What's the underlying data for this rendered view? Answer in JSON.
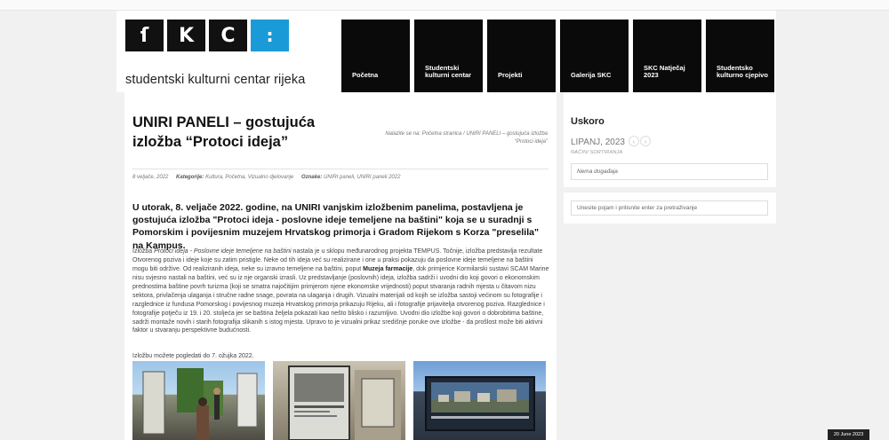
{
  "logo": {
    "letters": [
      "ſ",
      "K",
      "C",
      ":"
    ],
    "text": "studentski kulturni centar rijeka"
  },
  "nav": {
    "items": [
      {
        "label": "Početna"
      },
      {
        "label": "Studentski kulturni centar"
      },
      {
        "label": "Projekti"
      },
      {
        "label": "Galerija SKC"
      },
      {
        "label": "SKC Natječaj 2023"
      },
      {
        "label": "Studentsko kulturno cjepivo"
      }
    ]
  },
  "article": {
    "title": "UNIRI PANELI – gostujuća izložba “Protoci ideja”",
    "breadcrumb": "Nalazite se na: Početna stranica / UNIRI PANELI – gostujuća izložba “Protoci ideja”",
    "meta": {
      "date": "8 veljače, 2022",
      "categories_label": "Kategorije:",
      "categories": "Kultura, Početna, Vizualno djelovanje",
      "tags_label": "Oznake:",
      "tags": "UNIRI paneli, UNIRI paneli 2022"
    },
    "lead": "U utorak, 8. veljače 2022. godine, na UNIRI vanjskim izložbenim panelima, postavljena je gostujuća izložba \"Protoci ideja - poslovne ideje temeljene na baštini\" koja se u suradnji s Pomorskim i povijesnim muzejem Hrvatskog primorja i Gradom Rijekom s Korza \"preselila\" na Kampus.",
    "body": {
      "p1_intro": "Izložba ",
      "p1_title": "Protoci ideja - Poslovne ideje temeljene na baštini",
      "p1_a": " nastala je u sklopu međunarodnog projekta TEMPUS. Točnije, izložba predstavlja rezultate Otvorenog poziva i ideje koje su zatim pristigle. Neke od tih ideja već su realizirane i one u praksi pokazuju da poslovne ideje temeljene na baštini mogu biti održive. Od realiziranih ideja, neke su izravno temeljene na baštini, poput ",
      "p1_bold": "Muzeja farmacije",
      "p1_b": ", dok primjerice Kormilarski sustavi SCAM Marine nisu svjesno nastali na baštini, već su iz nje organski izrasli. Uz predstavljanje (poslovnih) ideja, izložba sadrži i uvodni dio koji govori o ekonomskim prednostima baštine povrh turizma (koji se smatra najočitijim primjerom njene ekonomske vrijednosti) poput stvaranja radnih mjesta u čitavom nizu sektora, privlačenja ulaganja i stručne radne snage, povrata na ulaganja i drugih. Vizualni materijali od kojih se izložba sastoji većinom su fotografije i razglednice iz fundusa Pomorskog i povijesnog muzeja Hrvatskog primorja prikazuju Rijeku, ali i fotografije prijavitelja otvorenog poziva. Razglednice i fotografije potječu iz 19. i 20. stoljeća jer se baština željela pokazati kao nešto blisko i razumljivo. Uvodni dio izložbe koji govori o dobrobitima baštine, sadrži montaže novih i starih fotografija slikanih s istog mjesta. Upravo to je vizualni prikaz središnje poruke ove izložbe - da prošlost može biti aktivni faktor u stvaranju perspektivne budućnosti."
    },
    "note": "Izložbu možete pogledati do 7. ožujka 2022."
  },
  "sidebar": {
    "upcoming_title": "Uskoro",
    "month": "LIPANJ, 2023",
    "prev_icon": "‹",
    "next_icon": "›",
    "sort_label": "NAČINI SORTIRANJA",
    "no_events": "Nema događaja",
    "search_placeholder": "Unesite pojam i pritisnite enter za pretraživanje"
  },
  "date_badge": "20 June 2023",
  "colors": {
    "accent": "#1a9bd7",
    "nav_bg": "#0a0a0a",
    "page_bg": "#f1f1f1"
  }
}
